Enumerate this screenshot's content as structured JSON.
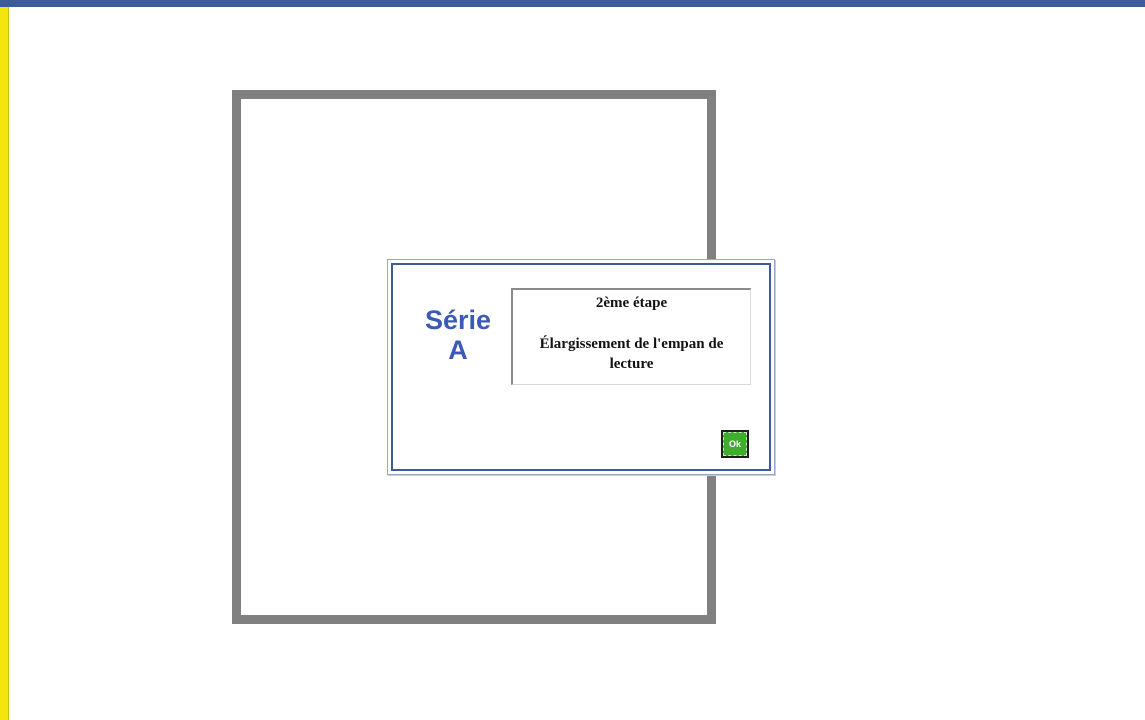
{
  "colors": {
    "top_bar": "#3a5c9a",
    "left_bar": "#f4e60c",
    "frame_border": "#808080",
    "serie_text": "#3b59b6",
    "ok_button": "#3fae2c"
  },
  "dialog": {
    "serie_label": "Série",
    "serie_letter": "A",
    "step_heading": "2ème étape",
    "step_description": "Élargissement de l'empan de lecture",
    "ok_label": "Ok"
  }
}
